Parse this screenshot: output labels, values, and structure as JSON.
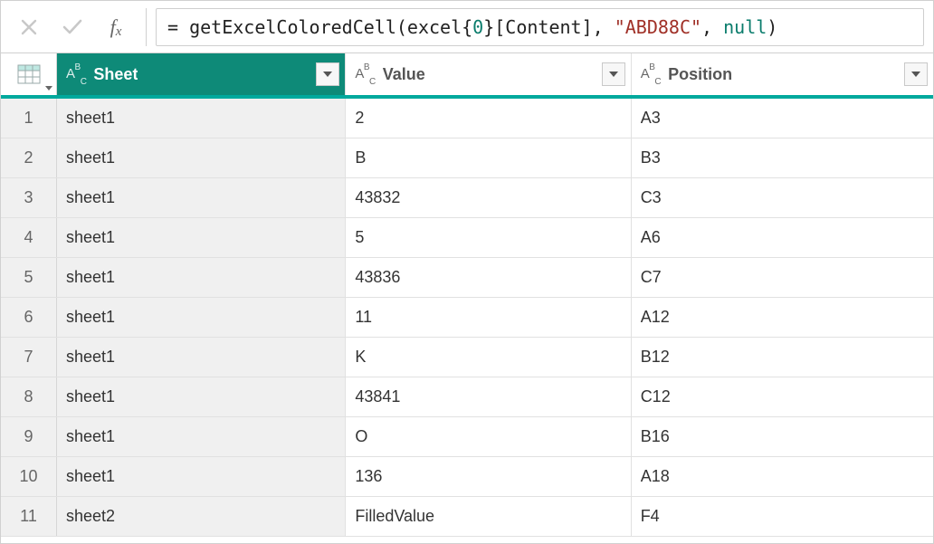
{
  "formula": {
    "prefix": "= getExcelColoredCell(excel{",
    "index": "0",
    "mid": "}[Content], ",
    "string": "\"ABD88C\"",
    "sep": ", ",
    "null": "null",
    "suffix": ")"
  },
  "columns": {
    "sheet": {
      "label": "Sheet",
      "type": "ABC"
    },
    "value": {
      "label": "Value",
      "type": "ABC"
    },
    "position": {
      "label": "Position",
      "type": "ABC"
    }
  },
  "rows": [
    {
      "n": "1",
      "sheet": "sheet1",
      "value": "2",
      "position": "A3"
    },
    {
      "n": "2",
      "sheet": "sheet1",
      "value": "B",
      "position": "B3"
    },
    {
      "n": "3",
      "sheet": "sheet1",
      "value": "43832",
      "position": "C3"
    },
    {
      "n": "4",
      "sheet": "sheet1",
      "value": "5",
      "position": "A6"
    },
    {
      "n": "5",
      "sheet": "sheet1",
      "value": "43836",
      "position": "C7"
    },
    {
      "n": "6",
      "sheet": "sheet1",
      "value": "11",
      "position": "A12"
    },
    {
      "n": "7",
      "sheet": "sheet1",
      "value": "K",
      "position": "B12"
    },
    {
      "n": "8",
      "sheet": "sheet1",
      "value": "43841",
      "position": "C12"
    },
    {
      "n": "9",
      "sheet": "sheet1",
      "value": "O",
      "position": "B16"
    },
    {
      "n": "10",
      "sheet": "sheet1",
      "value": "136",
      "position": "A18"
    },
    {
      "n": "11",
      "sheet": "sheet2",
      "value": "FilledValue",
      "position": "F4"
    }
  ]
}
